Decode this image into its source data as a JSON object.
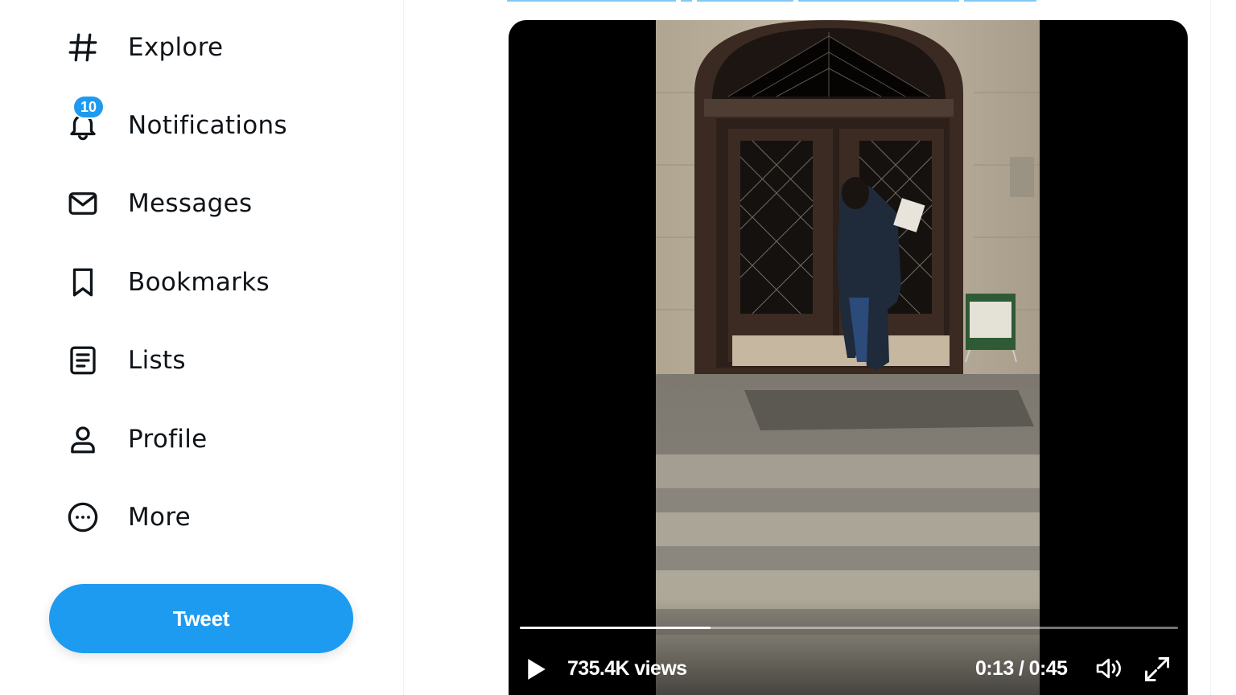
{
  "sidebar": {
    "items": [
      {
        "label": "Explore",
        "icon": "hashtag-icon"
      },
      {
        "label": "Notifications",
        "icon": "bell-icon",
        "badge": "10"
      },
      {
        "label": "Messages",
        "icon": "envelope-icon"
      },
      {
        "label": "Bookmarks",
        "icon": "bookmark-icon"
      },
      {
        "label": "Lists",
        "icon": "list-icon"
      },
      {
        "label": "Profile",
        "icon": "person-icon"
      },
      {
        "label": "More",
        "icon": "more-circle-icon"
      }
    ],
    "tweet_button": "Tweet"
  },
  "video": {
    "views": "735.4K views",
    "time": "0:13 / 0:45",
    "progress": 0.29,
    "icons": [
      "play-icon",
      "volume-icon",
      "fullscreen-icon"
    ]
  },
  "colors": {
    "accent": "#1d9bf0",
    "text": "#0f1419",
    "video_bg": "#000000"
  }
}
